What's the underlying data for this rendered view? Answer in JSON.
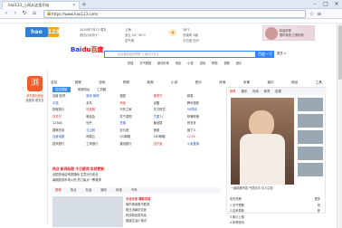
{
  "browser": {
    "tab_title": "hao123_上网从这里开始",
    "url": "https://www.hao123.com/"
  },
  "info": {
    "date": "2019年7月12 周五",
    "lunar": "农历六月初十",
    "city": "上海",
    "weather": "多云 24~30℃",
    "air": "空气良",
    "tip": "今日宜 出行",
    "temp": "26℃",
    "wind": "东南风 3级"
  },
  "logo": {
    "hao": "hao",
    "num": "123"
  },
  "ad": {
    "line1": "精选好物",
    "line2": "限时特惠 立即抢购"
  },
  "search": {
    "logo_a": "Bai",
    "logo_b": "du百度",
    "placeholder": "北京暴雨蓝色预警 上海今日多云",
    "button": "百度一下",
    "hot": "热搜 天气预报 新闻头条 电影 小说 游戏 购物 视频 音乐",
    "more": "更多 >"
  },
  "left_card": {
    "icon": "浏",
    "title": "浏览器加速版",
    "sub": "速度快 更安全"
  },
  "categories": [
    "名站",
    "视频",
    "游戏",
    "购物",
    "新闻",
    "小说",
    "音乐",
    "体育",
    "军事",
    "娱乐",
    "财经",
    "工具"
  ],
  "sub_tabs": [
    "名站导航",
    "常用网址",
    "工具箱"
  ],
  "grid": [
    [
      "百度·贴吧",
      "新浪·微博",
      "搜狐",
      "爱奇艺",
      "网易"
    ],
    [
      "天猫",
      "京东",
      "淘宝",
      "优酷",
      "腾讯视频"
    ],
    [
      "携程旅行",
      "凤凰网",
      "汽车之家",
      "东方财富",
      "58同城"
    ],
    [
      "中关村",
      "唯品会",
      "苏宁易购",
      "芒果TV",
      "哔哩哔哩"
    ],
    [
      "12306",
      "知乎",
      "豆瓣",
      "聚划算",
      "拼多多"
    ],
    [
      "国美在线",
      "当当网",
      "亚马逊",
      "美团",
      "饿了么"
    ],
    [
      "百度地图",
      "网易云",
      "QQ邮箱",
      "163邮箱",
      "CCTV"
    ],
    [
      "招商银行",
      "工商银行",
      "建设银行",
      "支付宝",
      "斗鱼直播"
    ]
  ],
  "right_panel": {
    "tabs": [
      "推荐",
      "娱乐",
      "时尚",
      "体育",
      "影视"
    ],
    "caption": "一组精美写真 气质出众 引人注目"
  },
  "news": {
    "headline": "热点 新闻标题 今日要闻 实时更新",
    "lines": [
      "全国多地迎来强降雨 注意出行安全",
      "暑期旅游市场火热 热门景点一票难求"
    ]
  },
  "news_tabs": [
    "推荐",
    "热点",
    "社会",
    "娱乐",
    "科技",
    "汽车"
  ],
  "bottom_news": {
    "headline": "今日头条 精彩内容",
    "lines": [
      "城市夜景美不胜收",
      "夏日消暑好去处",
      "科技新品发布会",
      "健康生活小常识"
    ]
  },
  "side_list": [
    [
      "实时热榜",
      "更多"
    ],
    [
      "1 天气预警",
      "热"
    ],
    [
      "2 高考录取",
      "新"
    ],
    [
      "3 新片上映",
      ""
    ],
    [
      "4 体育快讯",
      ""
    ]
  ]
}
